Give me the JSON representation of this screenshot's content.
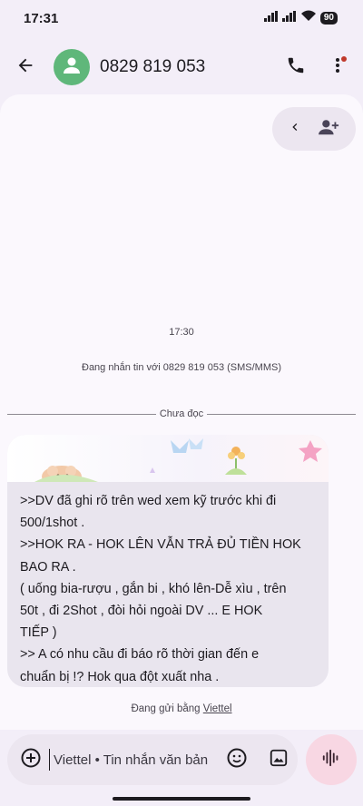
{
  "status": {
    "time": "17:31",
    "battery": "90",
    "icons": [
      "signal-icon",
      "signal-icon",
      "wifi-icon",
      "battery-icon"
    ]
  },
  "header": {
    "contact": "0829 819 053",
    "icons": [
      "back-arrow-icon",
      "avatar-person-icon",
      "phone-icon",
      "more-vert-icon"
    ]
  },
  "actions": {
    "icons": [
      "chevron-left-icon",
      "add-person-icon"
    ]
  },
  "conversation": {
    "timestamp": "17:30",
    "texting_note": "Đang nhắn tin với 0829 819 053 (SMS/MMS)",
    "unread_label": "Chưa đọc",
    "message": ">>DV đã ghi rõ trên wed xem kỹ trước khi đi\n500/1shot .\n>>HOK RA - HOK LÊN VẪN TRẢ ĐỦ TIỀN HOK\nBAO RA .\n( uống bia-rượu , gắn bi , khó lên-Dễ xìu , trên\n50t , đi 2Shot , đòi hỏi ngoài DV ... E HOK\nTIẾP )\n>> A có nhu cầu đi báo rõ thời gian đến e\nchuẩn bị !? Hok qua đột xuất nha ."
  },
  "footer": {
    "sending_prefix": "Đang gửi bằng",
    "carrier": "Viettel"
  },
  "compose": {
    "placeholder": "Viettel • Tin nhắn văn bản",
    "icons": [
      "add-circle-icon",
      "emoji-icon",
      "gallery-icon",
      "voice-waveform-icon"
    ]
  },
  "colors": {
    "accent_avatar": "#5fb77a",
    "voice_button": "#f8d7e3",
    "bubble": "#e9e5ee"
  }
}
